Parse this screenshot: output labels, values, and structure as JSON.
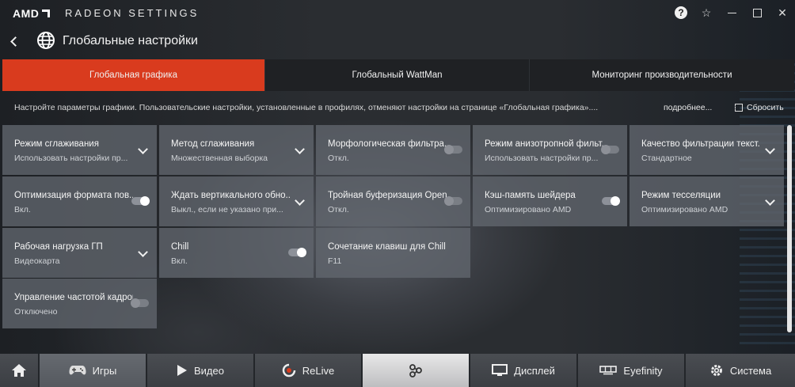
{
  "window": {
    "brand": "AMD",
    "app_name": "RADEON SETTINGS",
    "help_label": "?",
    "star_label": "☆",
    "close_label": "✕"
  },
  "header": {
    "title": "Глобальные настройки"
  },
  "tabs": [
    {
      "label": "Глобальная графика",
      "active": true
    },
    {
      "label": "Глобальный WattMan",
      "active": false
    },
    {
      "label": "Мониторинг производительности",
      "active": false
    }
  ],
  "infobar": {
    "text": "Настройте параметры графики. Пользовательские настройки, установленные в профилях, отменяют настройки на странице «Глобальная графика»....",
    "more_link": "подробнее...",
    "reset_label": "Сбросить"
  },
  "settings": [
    {
      "title": "Режим сглаживания",
      "value": "Использовать настройки пр...",
      "control": "dropdown"
    },
    {
      "title": "Метод сглаживания",
      "value": "Множественная выборка",
      "control": "dropdown"
    },
    {
      "title": "Морфологическая фильтра...",
      "value": "Откл.",
      "control": "toggle",
      "on": false
    },
    {
      "title": "Режим анизотропной фильт...",
      "value": "Использовать настройки пр...",
      "control": "toggle",
      "on": false
    },
    {
      "title": "Качество фильтрации текст...",
      "value": "Стандартное",
      "control": "dropdown"
    },
    {
      "title": "Оптимизация формата пов...",
      "value": "Вкл.",
      "control": "toggle",
      "on": true
    },
    {
      "title": "Ждать вертикального обно...",
      "value": "Выкл., если не указано при...",
      "control": "dropdown"
    },
    {
      "title": "Тройная буферизация Open...",
      "value": "Откл.",
      "control": "toggle",
      "on": false
    },
    {
      "title": "Кэш-память шейдера",
      "value": "Оптимизировано AMD",
      "control": "toggle",
      "on": true
    },
    {
      "title": "Режим тесселяции",
      "value": "Оптимизировано AMD",
      "control": "dropdown"
    },
    {
      "title": "Рабочая нагрузка ГП",
      "value": "Видеокарта",
      "control": "dropdown"
    },
    {
      "title": "Chill",
      "value": "Вкл.",
      "control": "toggle",
      "on": true
    },
    {
      "title": "Сочетание клавиш для Chill",
      "value": "F11",
      "control": "none"
    },
    {
      "title": "Управление частотой кадров",
      "value": "Отключено",
      "control": "toggle",
      "on": false
    }
  ],
  "bottomnav": [
    {
      "label": "",
      "icon": "home-icon"
    },
    {
      "label": "Игры",
      "icon": "gamepad-icon",
      "active": true
    },
    {
      "label": "Видео",
      "icon": "play-icon"
    },
    {
      "label": "ReLive",
      "icon": "relive-icon"
    },
    {
      "label": "",
      "icon": "share-icon",
      "center": true
    },
    {
      "label": "Дисплей",
      "icon": "monitor-icon"
    },
    {
      "label": "Eyefinity",
      "icon": "eyefinity-icon"
    },
    {
      "label": "Система",
      "icon": "gear-icon"
    }
  ]
}
